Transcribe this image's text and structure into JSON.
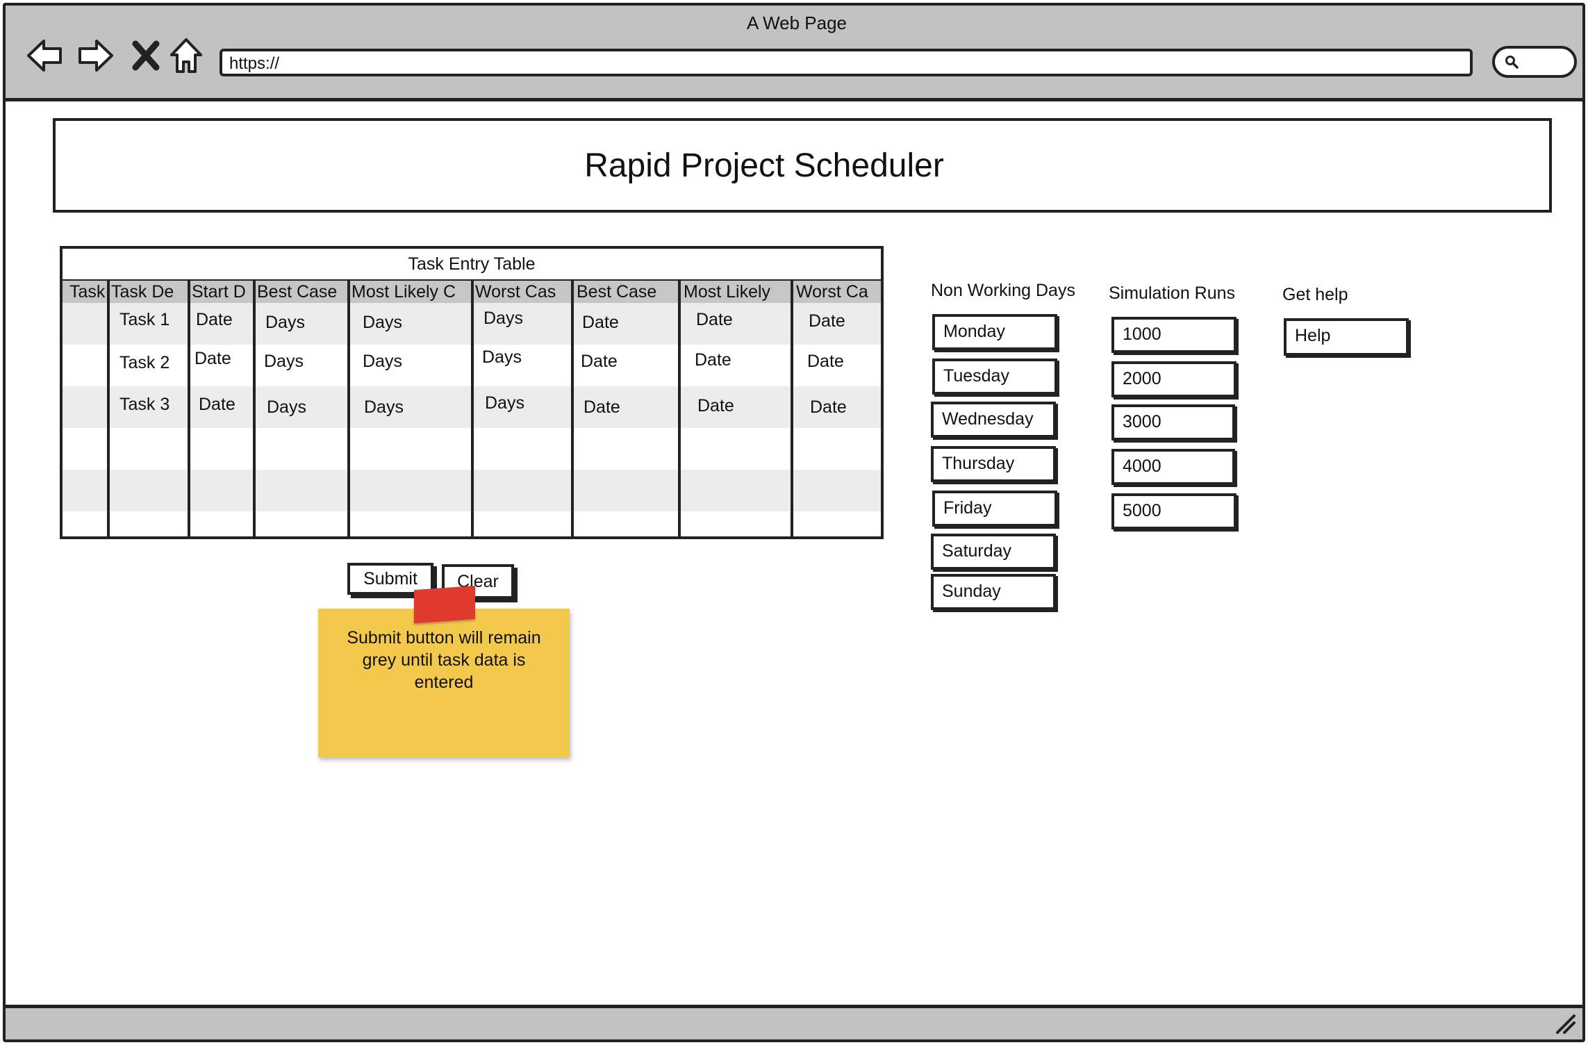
{
  "window": {
    "title": "A Web Page",
    "url": "https://"
  },
  "header": {
    "title": "Rapid Project Scheduler"
  },
  "task_table": {
    "caption": "Task Entry Table",
    "columns": [
      "Task",
      "Task De",
      "Start D",
      "Best Case",
      "Most Likely C",
      "Worst Cas",
      "Best Case",
      "Most Likely",
      "Worst Ca"
    ],
    "rows": [
      [
        "",
        "Task 1",
        "Date",
        "Days",
        "Days",
        "Days",
        "Date",
        "Date",
        "Date"
      ],
      [
        "",
        "Task 2",
        "Date",
        "Days",
        "Days",
        "Days",
        "Date",
        "Date",
        "Date"
      ],
      [
        "",
        "Task 3",
        "Date",
        "Days",
        "Days",
        "Days",
        "Date",
        "Date",
        "Date"
      ]
    ]
  },
  "actions": {
    "submit_label": "Submit",
    "clear_label": "Clear"
  },
  "sticky_note": {
    "text": "Submit button will remain grey until task data is entered"
  },
  "non_working_days": {
    "label": "Non Working Days",
    "items": [
      "Monday",
      "Tuesday",
      "Wednesday",
      "Thursday",
      "Friday",
      "Saturday",
      "Sunday"
    ]
  },
  "simulation_runs": {
    "label": "Simulation Runs",
    "items": [
      "1000",
      "2000",
      "3000",
      "4000",
      "5000"
    ]
  },
  "help": {
    "label": "Get help",
    "button_label": "Help"
  },
  "colors": {
    "chrome": "#c2c2c2",
    "sticky": "#f2c94c",
    "tape": "#e03a2f",
    "stripe": "#ececec",
    "header_row": "#c6c6c6"
  },
  "icons": [
    "back-arrow-icon",
    "forward-arrow-icon",
    "close-icon",
    "home-icon",
    "search-icon",
    "resize-grip-icon"
  ]
}
